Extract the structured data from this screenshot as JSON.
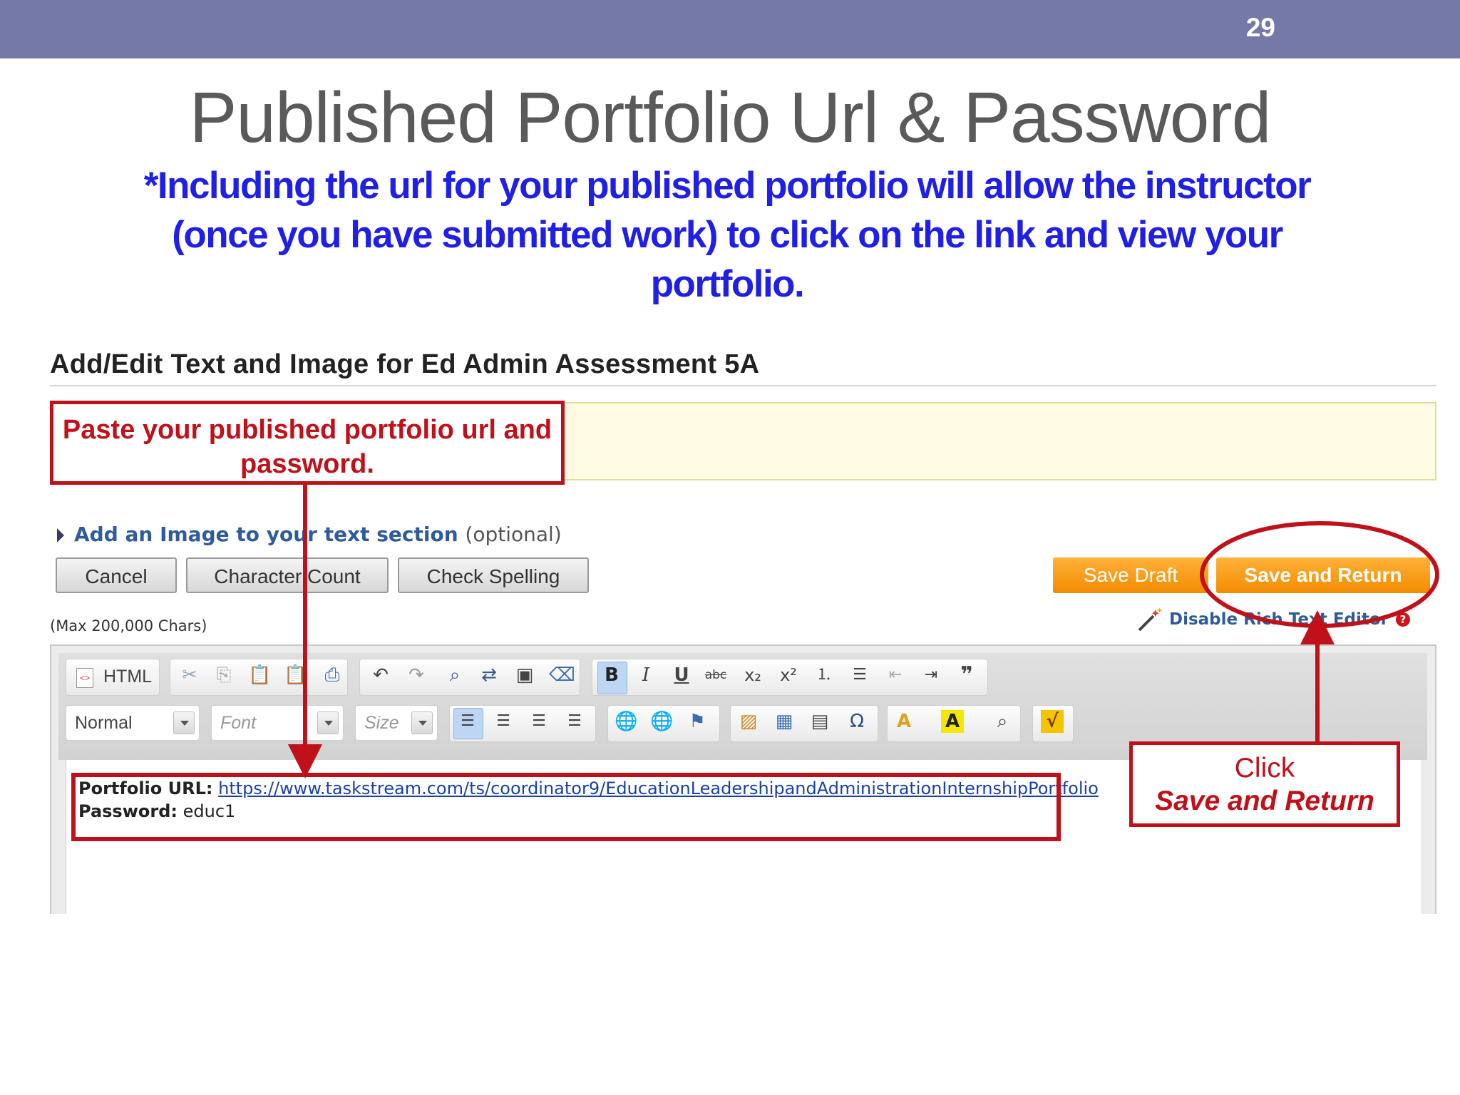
{
  "slide": {
    "number": "29",
    "title": "Published Portfolio Url & Password",
    "subtitle": "*Including the url for your published portfolio will allow the instructor (once you have submitted work) to click on the link and view your portfolio."
  },
  "form": {
    "heading": "Add/Edit Text and Image for Ed Admin Assessment 5A",
    "add_image_label": "Add an Image to your text section",
    "add_image_optional": "(optional)",
    "max_chars": "(Max 200,000 Chars)",
    "disable_rte": "Disable Rich Text Editor",
    "help": "?"
  },
  "buttons": {
    "cancel": "Cancel",
    "character_count": "Character Count",
    "check_spelling": "Check Spelling",
    "save_draft": "Save Draft",
    "save_and_return": "Save and Return"
  },
  "toolbar": {
    "html": "HTML",
    "format": "Normal",
    "font": "Font",
    "size": "Size"
  },
  "content": {
    "url_label": "Portfolio URL:",
    "url": "https://www.taskstream.com/ts/coordinator9/EducationLeadershipandAdministrationInternshipPortfolio",
    "password_label": "Password:",
    "password": "educ1"
  },
  "callouts": {
    "paste_instruction": "Paste your published portfolio url and password.",
    "click_line1": "Click",
    "click_line2": "Save and Return"
  },
  "colors": {
    "topbar": "#7479a7",
    "subtitle": "#1f1fe6",
    "callout_red": "#c0111a",
    "orange_button": "#f28b00"
  }
}
